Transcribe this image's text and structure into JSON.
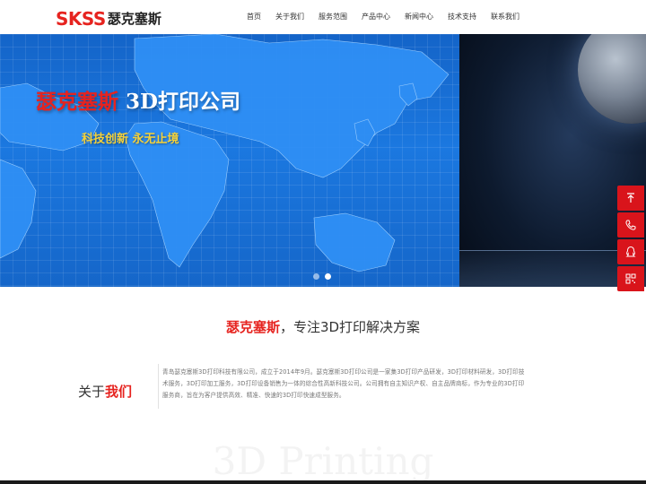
{
  "header": {
    "logo_mark": "SKSS",
    "logo_text": "瑟克塞斯",
    "nav": [
      "首页",
      "关于我们",
      "服务范围",
      "产品中心",
      "新闻中心",
      "技术支持",
      "联系我们"
    ]
  },
  "banner": {
    "title_red": "瑟克塞斯",
    "title_white": " 3D打印公司",
    "subtitle": "科技创新 永无止境",
    "slides": 2,
    "active_slide": 2
  },
  "side_buttons": [
    "top-arrow-icon",
    "phone-icon",
    "qq-icon",
    "qrcode-icon"
  ],
  "about": {
    "heading_red": "瑟克塞斯",
    "heading_rest": "，专注3D打印解决方案",
    "label_black": "关于",
    "label_red": "我们",
    "text": "青岛瑟克塞斯3D打印科技有限公司，成立于2014年9月。瑟克塞斯3D打印公司是一家集3D打印产品研发，3D打印材料研发，3D打印技术服务，3D打印加工服务，3D打印设备销售为一体的综合性高新科技公司。公司拥有自主知识产权、自主品牌商标，作为专业的3D打印服务商，旨在为客户提供高效、精准、快速的3D打印快速成型服务。",
    "watermark": "3D Printing"
  },
  "colors": {
    "brand_red": "#e6231f",
    "banner_blue": "#1b78e0",
    "side_red": "#d9141b",
    "subtitle_yellow": "#f5d23a"
  }
}
